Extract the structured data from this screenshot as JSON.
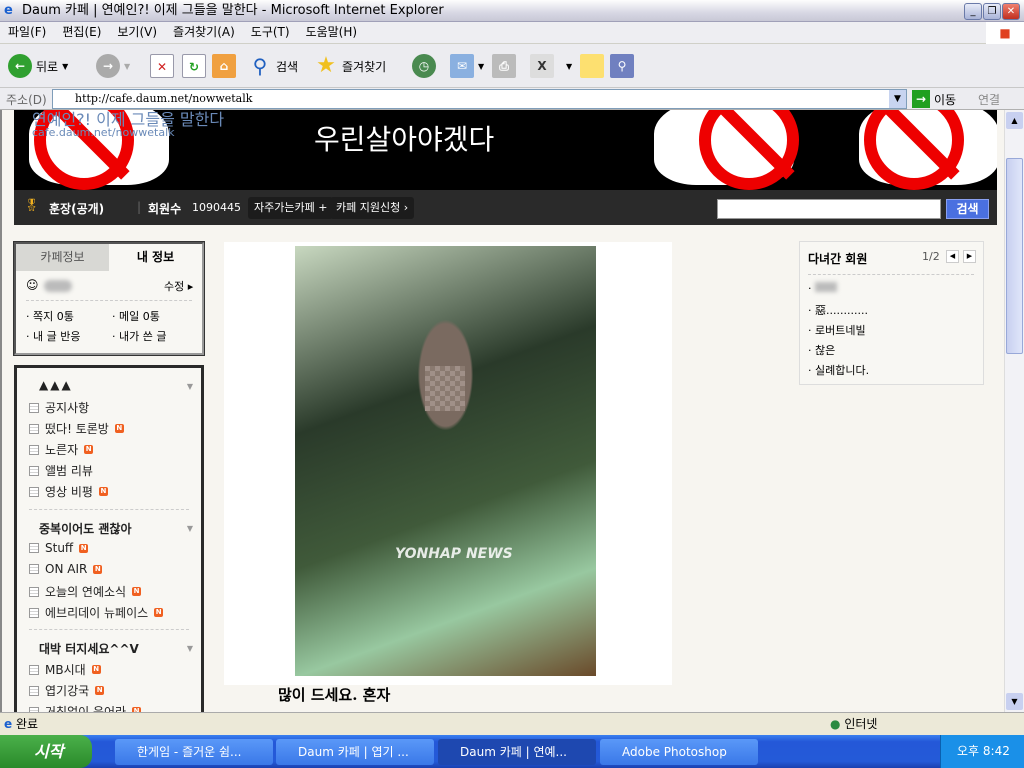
{
  "window": {
    "title": "Daum 카페 | 연예인?! 이제 그들을 말한다 - Microsoft Internet Explorer"
  },
  "menu": [
    "파일(F)",
    "편집(E)",
    "보기(V)",
    "즐겨찾기(A)",
    "도구(T)",
    "도움말(H)"
  ],
  "toolbar": {
    "back": "뒤로",
    "search": "검색",
    "favorites": "즐겨찾기"
  },
  "address": {
    "label": "주소(D)",
    "url": "http://cafe.daum.net/nowwetalk",
    "go": "이동",
    "links": "연결"
  },
  "banner": {
    "cafe_name": "연예인?! 이제 그들을 말한다",
    "cafe_url": "cafe.daum.net/nowwetalk",
    "slogan": "우린살아야겠다"
  },
  "nav": {
    "owner": "훈장(공개)",
    "members_label": "회원수",
    "members_count": "1090445",
    "fav_cafe": "자주가는카페",
    "support": "카페 지원신청 ›",
    "search_button": "검색"
  },
  "info": {
    "tab_cafe": "카페정보",
    "tab_mine": "내 정보",
    "edit": "수정",
    "links": [
      "쪽지 0통",
      "메일 0통",
      "내 글 반응",
      "내가 쓴 글"
    ]
  },
  "boards": {
    "group1": "",
    "items1": [
      {
        "label": "공지사항",
        "new": false
      },
      {
        "label": "떴다! 토론방",
        "new": true
      },
      {
        "label": "노른자",
        "new": true
      },
      {
        "label": "앨범 리뷰",
        "new": false
      },
      {
        "label": "영상 비평",
        "new": true
      }
    ],
    "group2": "중복이어도 괜찮아",
    "items2": [
      {
        "label": "Stuff",
        "new": true
      },
      {
        "label": "ON AIR",
        "new": true
      },
      {
        "label": "오늘의 연예소식",
        "new": true
      },
      {
        "label": "에브리데이 뉴페이스",
        "new": true
      }
    ],
    "group3": "대박 터지세요^^V",
    "items3": [
      {
        "label": "MB시대",
        "new": true
      },
      {
        "label": "엽기강국",
        "new": true
      },
      {
        "label": "거침없이 음어라",
        "new": true
      }
    ],
    "new_badge": "N"
  },
  "post": {
    "watermark": "YONHAP NEWS",
    "caption": "많이 드세요. 혼자"
  },
  "visitors": {
    "title": "다녀간 회원",
    "page": "1/2",
    "names": [
      "惡............",
      "로버트네빌",
      "찮은",
      "실례합니다."
    ]
  },
  "status": {
    "text": "완료",
    "zone": "인터넷"
  },
  "taskbar": {
    "start": "시작",
    "tasks": [
      "한게임 - 즐거운 쉼...",
      "Daum 카페 | 엽기 ...",
      "Daum 카페 | 연예...",
      "Adobe Photoshop"
    ],
    "clock": "오후 8:42"
  }
}
